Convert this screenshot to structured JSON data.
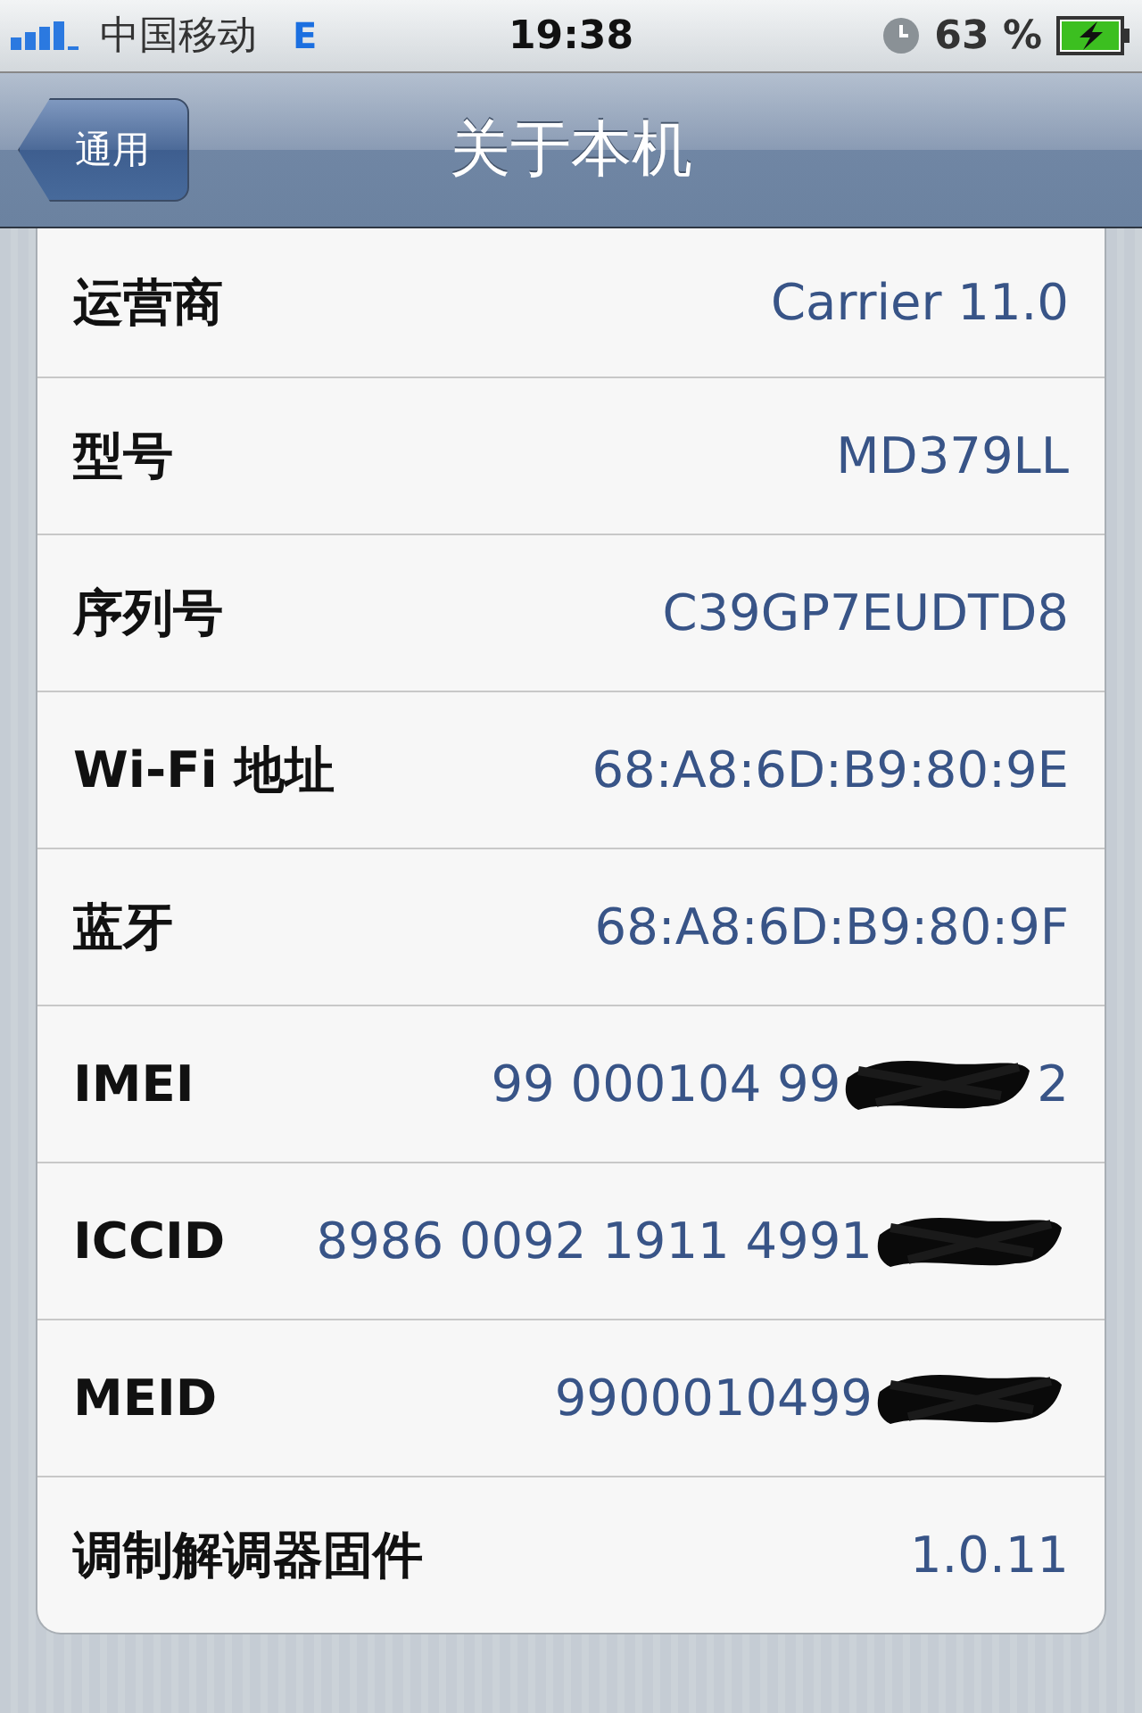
{
  "status_bar": {
    "carrier": "中国移动",
    "network": "E",
    "time": "19:38",
    "battery_text": "63 %"
  },
  "nav_bar": {
    "back": "通用",
    "title": "关于本机"
  },
  "rows": [
    {
      "label": "运营商",
      "value": "Carrier 11.0",
      "redacted": false
    },
    {
      "label": "型号",
      "value": "MD379LL",
      "redacted": false
    },
    {
      "label": "序列号",
      "value": "C39GP7EUDTD8",
      "redacted": false
    },
    {
      "label": "Wi-Fi 地址",
      "value": "68:A8:6D:B9:80:9E",
      "redacted": false
    },
    {
      "label": "蓝牙",
      "value": "68:A8:6D:B9:80:9F",
      "redacted": false
    },
    {
      "label": "IMEI",
      "value": "99 000104 99",
      "redacted": true,
      "tail": "2"
    },
    {
      "label": "ICCID",
      "value": "8986 0092 1911 4991",
      "redacted": true
    },
    {
      "label": "MEID",
      "value": "9900010499",
      "redacted": true
    },
    {
      "label": "调制解调器固件",
      "value": "1.0.11",
      "redacted": false
    }
  ]
}
